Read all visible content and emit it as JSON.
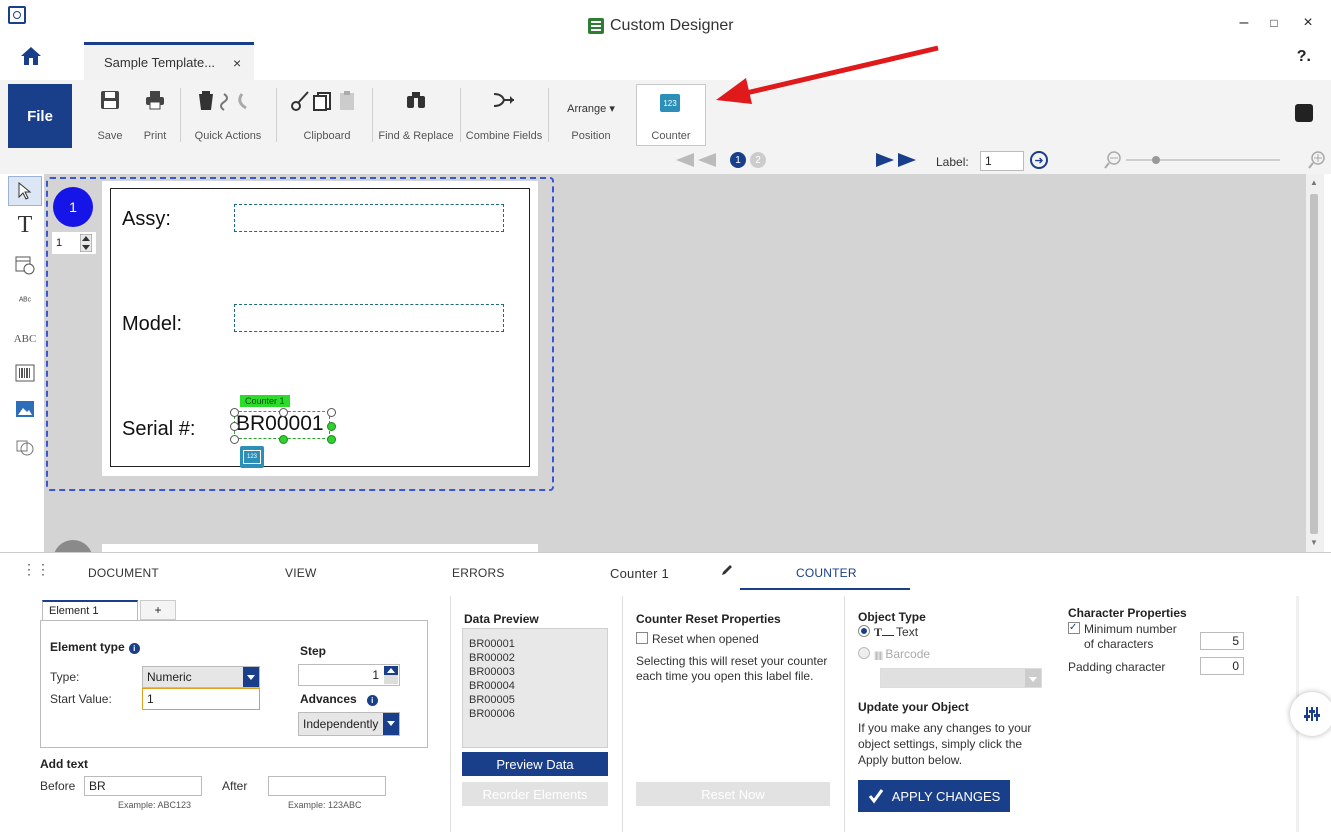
{
  "window": {
    "title": "Custom Designer",
    "minimize": "–",
    "maximize": "□",
    "close": "×"
  },
  "tabs": {
    "doc_tab_label": "Sample Template...",
    "doc_tab_close": "×",
    "help": "?."
  },
  "ribbon": {
    "file": "File",
    "save": "Save",
    "print": "Print",
    "quick_actions": "Quick Actions",
    "clipboard": "Clipboard",
    "find_replace": "Find & Replace",
    "combine_fields": "Combine Fields",
    "arrange": "Arrange ▾",
    "position": "Position",
    "counter": "Counter",
    "counter_icon_text": "123"
  },
  "navbar": {
    "page1": "1",
    "page2": "2",
    "label_prefix": "Label:",
    "label_value": "1"
  },
  "canvas": {
    "page_number": "1",
    "copies": "1",
    "assy_label": "Assy:",
    "model_label": "Model:",
    "serial_label": "Serial #:",
    "serial_value": "BR00001",
    "counter_tag": "Counter 1",
    "counter_badge": "123"
  },
  "panel_tabs": {
    "document": "DOCUMENT",
    "view": "VIEW",
    "errors": "ERRORS",
    "object_name": "Counter 1",
    "counter": "COUNTER"
  },
  "element": {
    "tab": "Element 1",
    "add_tab": "+",
    "element_type": "Element type",
    "type_label": "Type:",
    "type_value": "Numeric",
    "start_label": "Start Value:",
    "start_value": "1",
    "step_label": "Step",
    "step_value": "1",
    "advances_label": "Advances",
    "advances_value": "Independently",
    "add_text": "Add text",
    "before_label": "Before",
    "before_value": "BR",
    "after_label": "After",
    "after_value": "",
    "before_example": "Example: ABC123",
    "after_example": "Example: 123ABC"
  },
  "data_preview": {
    "title": "Data Preview",
    "items": [
      "BR00001",
      "BR00002",
      "BR00003",
      "BR00004",
      "BR00005",
      "BR00006"
    ],
    "preview_btn": "Preview Data",
    "reorder_btn": "Reorder Elements"
  },
  "reset_props": {
    "title": "Counter Reset Properties",
    "checkbox": "Reset when opened",
    "description": "Selecting this will reset your counter each time you open this label file.",
    "reset_btn": "Reset Now"
  },
  "object_type": {
    "title": "Object Type",
    "text_option": "Text",
    "barcode_option": "Barcode",
    "update_title": "Update your Object",
    "update_desc": "If you make any changes to your object settings, simply click the Apply button below.",
    "apply_btn": "APPLY CHANGES"
  },
  "char_props": {
    "title": "Character Properties",
    "min_chars_line1": "Minimum number",
    "min_chars_line2": "of characters",
    "min_chars_value": "5",
    "padding_label": "Padding character",
    "padding_value": "0"
  },
  "colors": {
    "brand": "#1a3f8a",
    "counter_green": "#2bdc2b",
    "arrow_red": "#e0191b"
  }
}
